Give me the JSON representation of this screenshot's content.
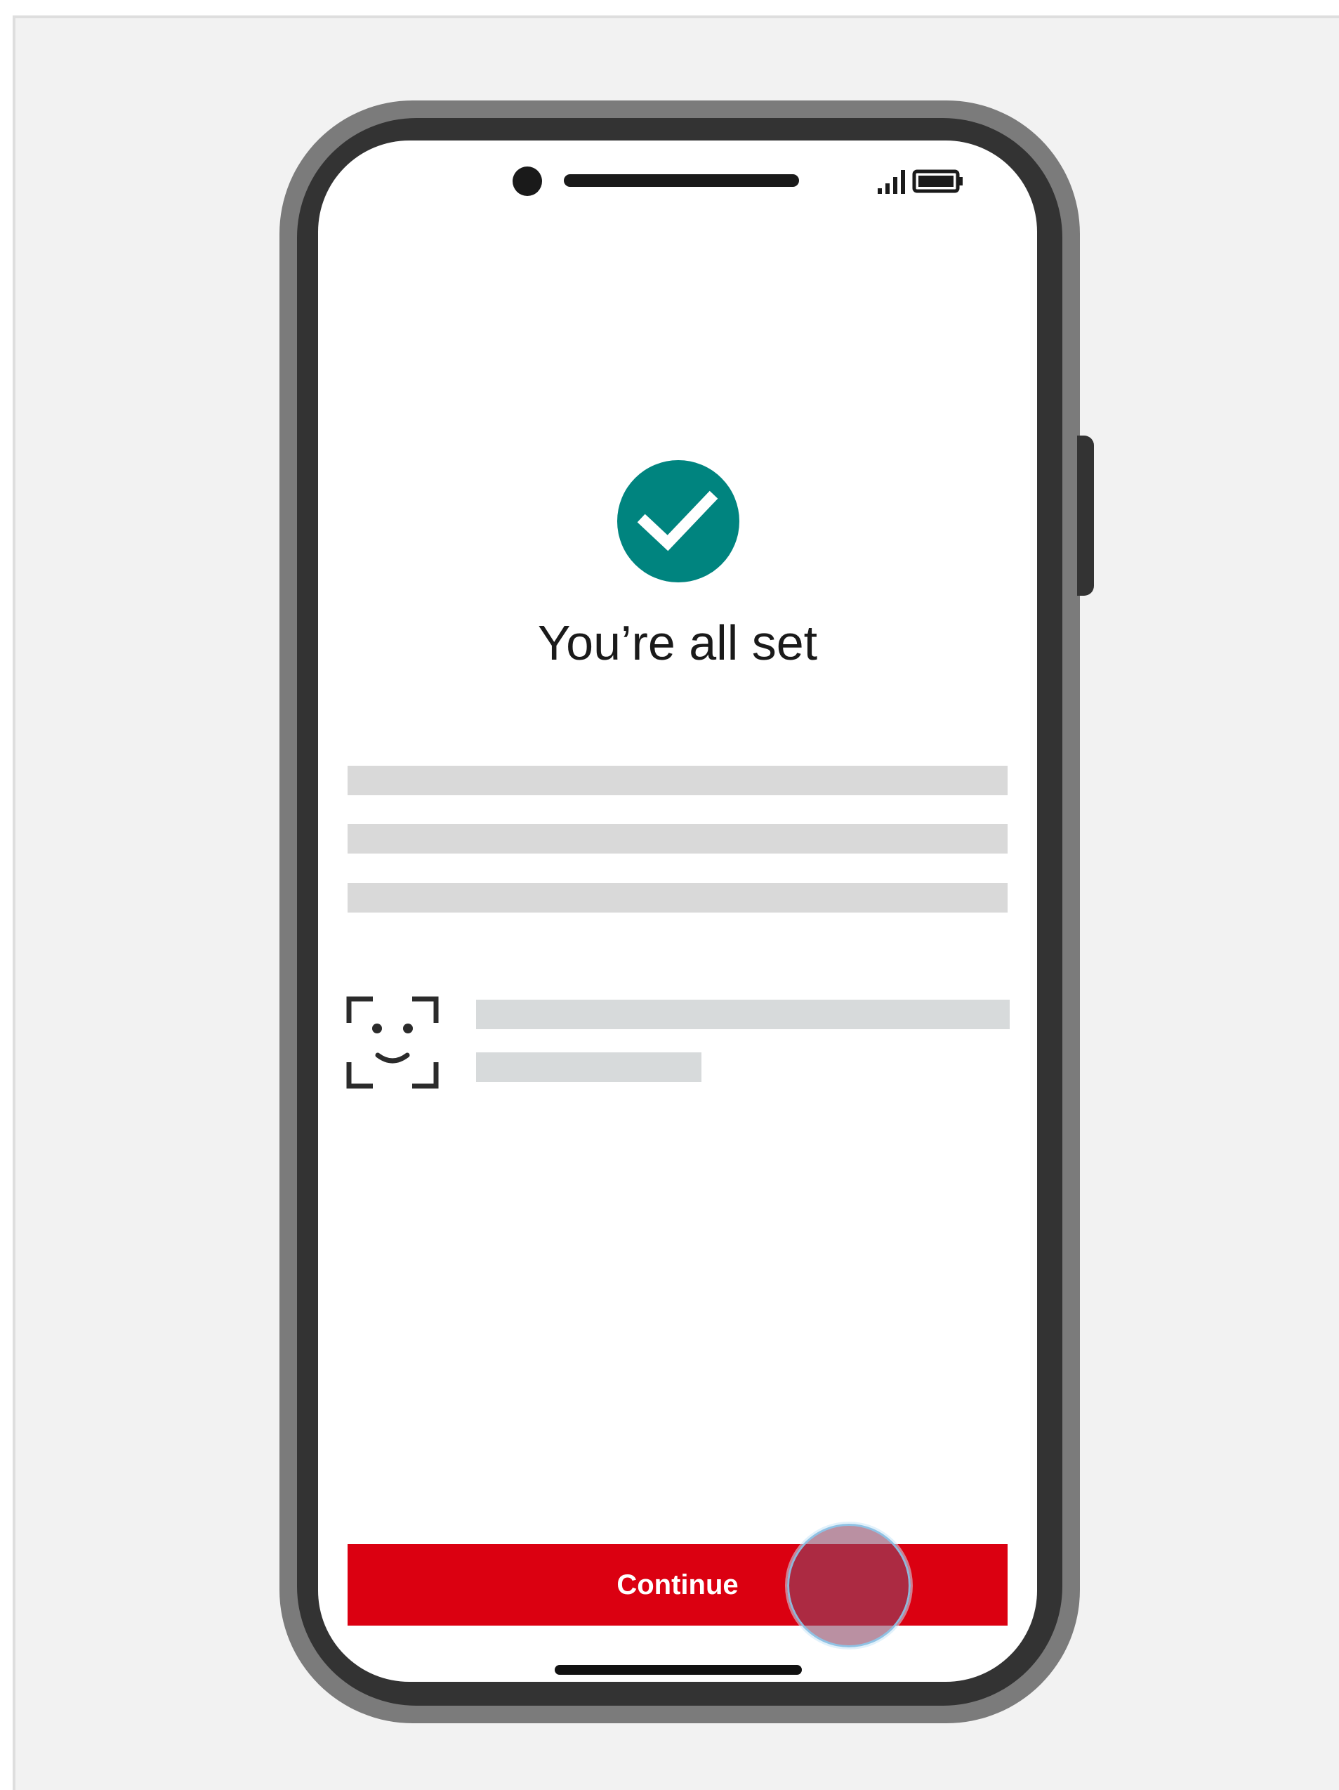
{
  "screen": {
    "title": "You’re all set",
    "success_icon": "check-circle-icon",
    "face_id_icon": "face-id-icon",
    "status_icons": [
      "signal-icon",
      "battery-icon"
    ]
  },
  "actions": {
    "continue_label": "Continue"
  },
  "colors": {
    "primary_button": "#db0011",
    "success": "#00847f",
    "placeholder": "#d9d9d9",
    "frame_background": "#f2f2f2"
  }
}
